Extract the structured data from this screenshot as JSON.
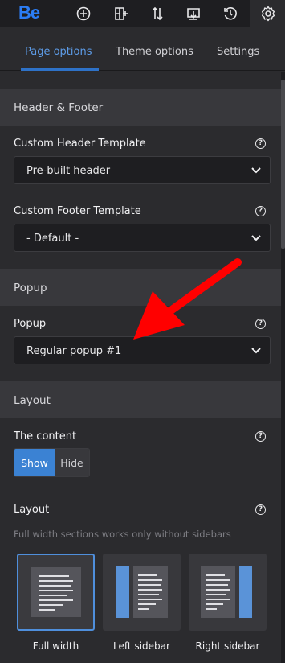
{
  "toolbar": {
    "logo": "Be",
    "icons": [
      "add-icon",
      "add-section-icon",
      "sort-icon",
      "import-icon",
      "history-icon",
      "settings-icon"
    ]
  },
  "tabs": [
    {
      "label": "Page options",
      "active": true
    },
    {
      "label": "Theme options",
      "active": false
    },
    {
      "label": "Settings",
      "active": false
    }
  ],
  "sections": {
    "header_footer": {
      "title": "Header & Footer",
      "header_template": {
        "label": "Custom Header Template",
        "value": "Pre-built header"
      },
      "footer_template": {
        "label": "Custom Footer Template",
        "value": "- Default -"
      }
    },
    "popup": {
      "title": "Popup",
      "field": {
        "label": "Popup",
        "value": "Regular popup #1"
      }
    },
    "layout": {
      "title": "Layout",
      "content": {
        "label": "The content",
        "options": [
          "Show",
          "Hide"
        ],
        "selected": "Show"
      },
      "layout_field": {
        "label": "Layout",
        "hint": "Full width sections works only without sidebars",
        "options": [
          "Full width",
          "Left sidebar",
          "Right sidebar"
        ],
        "selected": "Full width"
      }
    }
  },
  "help_glyph": "?",
  "colors": {
    "accent": "#3b82d3",
    "annotation_arrow": "#ff0000"
  }
}
